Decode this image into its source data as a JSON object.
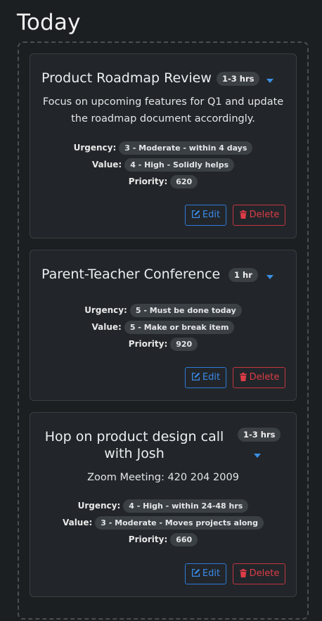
{
  "page": {
    "heading": "Today"
  },
  "labels": {
    "urgency": "Urgency:",
    "value": "Value:",
    "priority": "Priority:"
  },
  "actions": {
    "edit": "Edit",
    "delete": "Delete"
  },
  "colors": {
    "edit": "#2f79d8",
    "delete": "#c2353f",
    "caret": "#3b8fe6"
  },
  "cards": [
    {
      "title": "Product Roadmap Review",
      "duration": "1-3 hrs",
      "description": [
        "Focus on upcoming features for Q1 and update",
        "the roadmap document accordingly."
      ],
      "urgency": "3 - Moderate - within 4 days",
      "value": "4 - High - Solidly helps",
      "priority": "620"
    },
    {
      "title": "Parent-Teacher Conference",
      "duration": "1 hr",
      "description": [],
      "urgency": "5 - Must be done today",
      "value": "5 - Make or break item",
      "priority": "920"
    },
    {
      "title_lines": [
        "Hop on product design call",
        "with Josh"
      ],
      "duration": "1-3 hrs",
      "description": [
        "Zoom Meeting: 420 204 2009"
      ],
      "urgency": "4 - High - within 24-48 hrs",
      "value": "3 - Moderate - Moves projects along",
      "priority": "660"
    }
  ]
}
